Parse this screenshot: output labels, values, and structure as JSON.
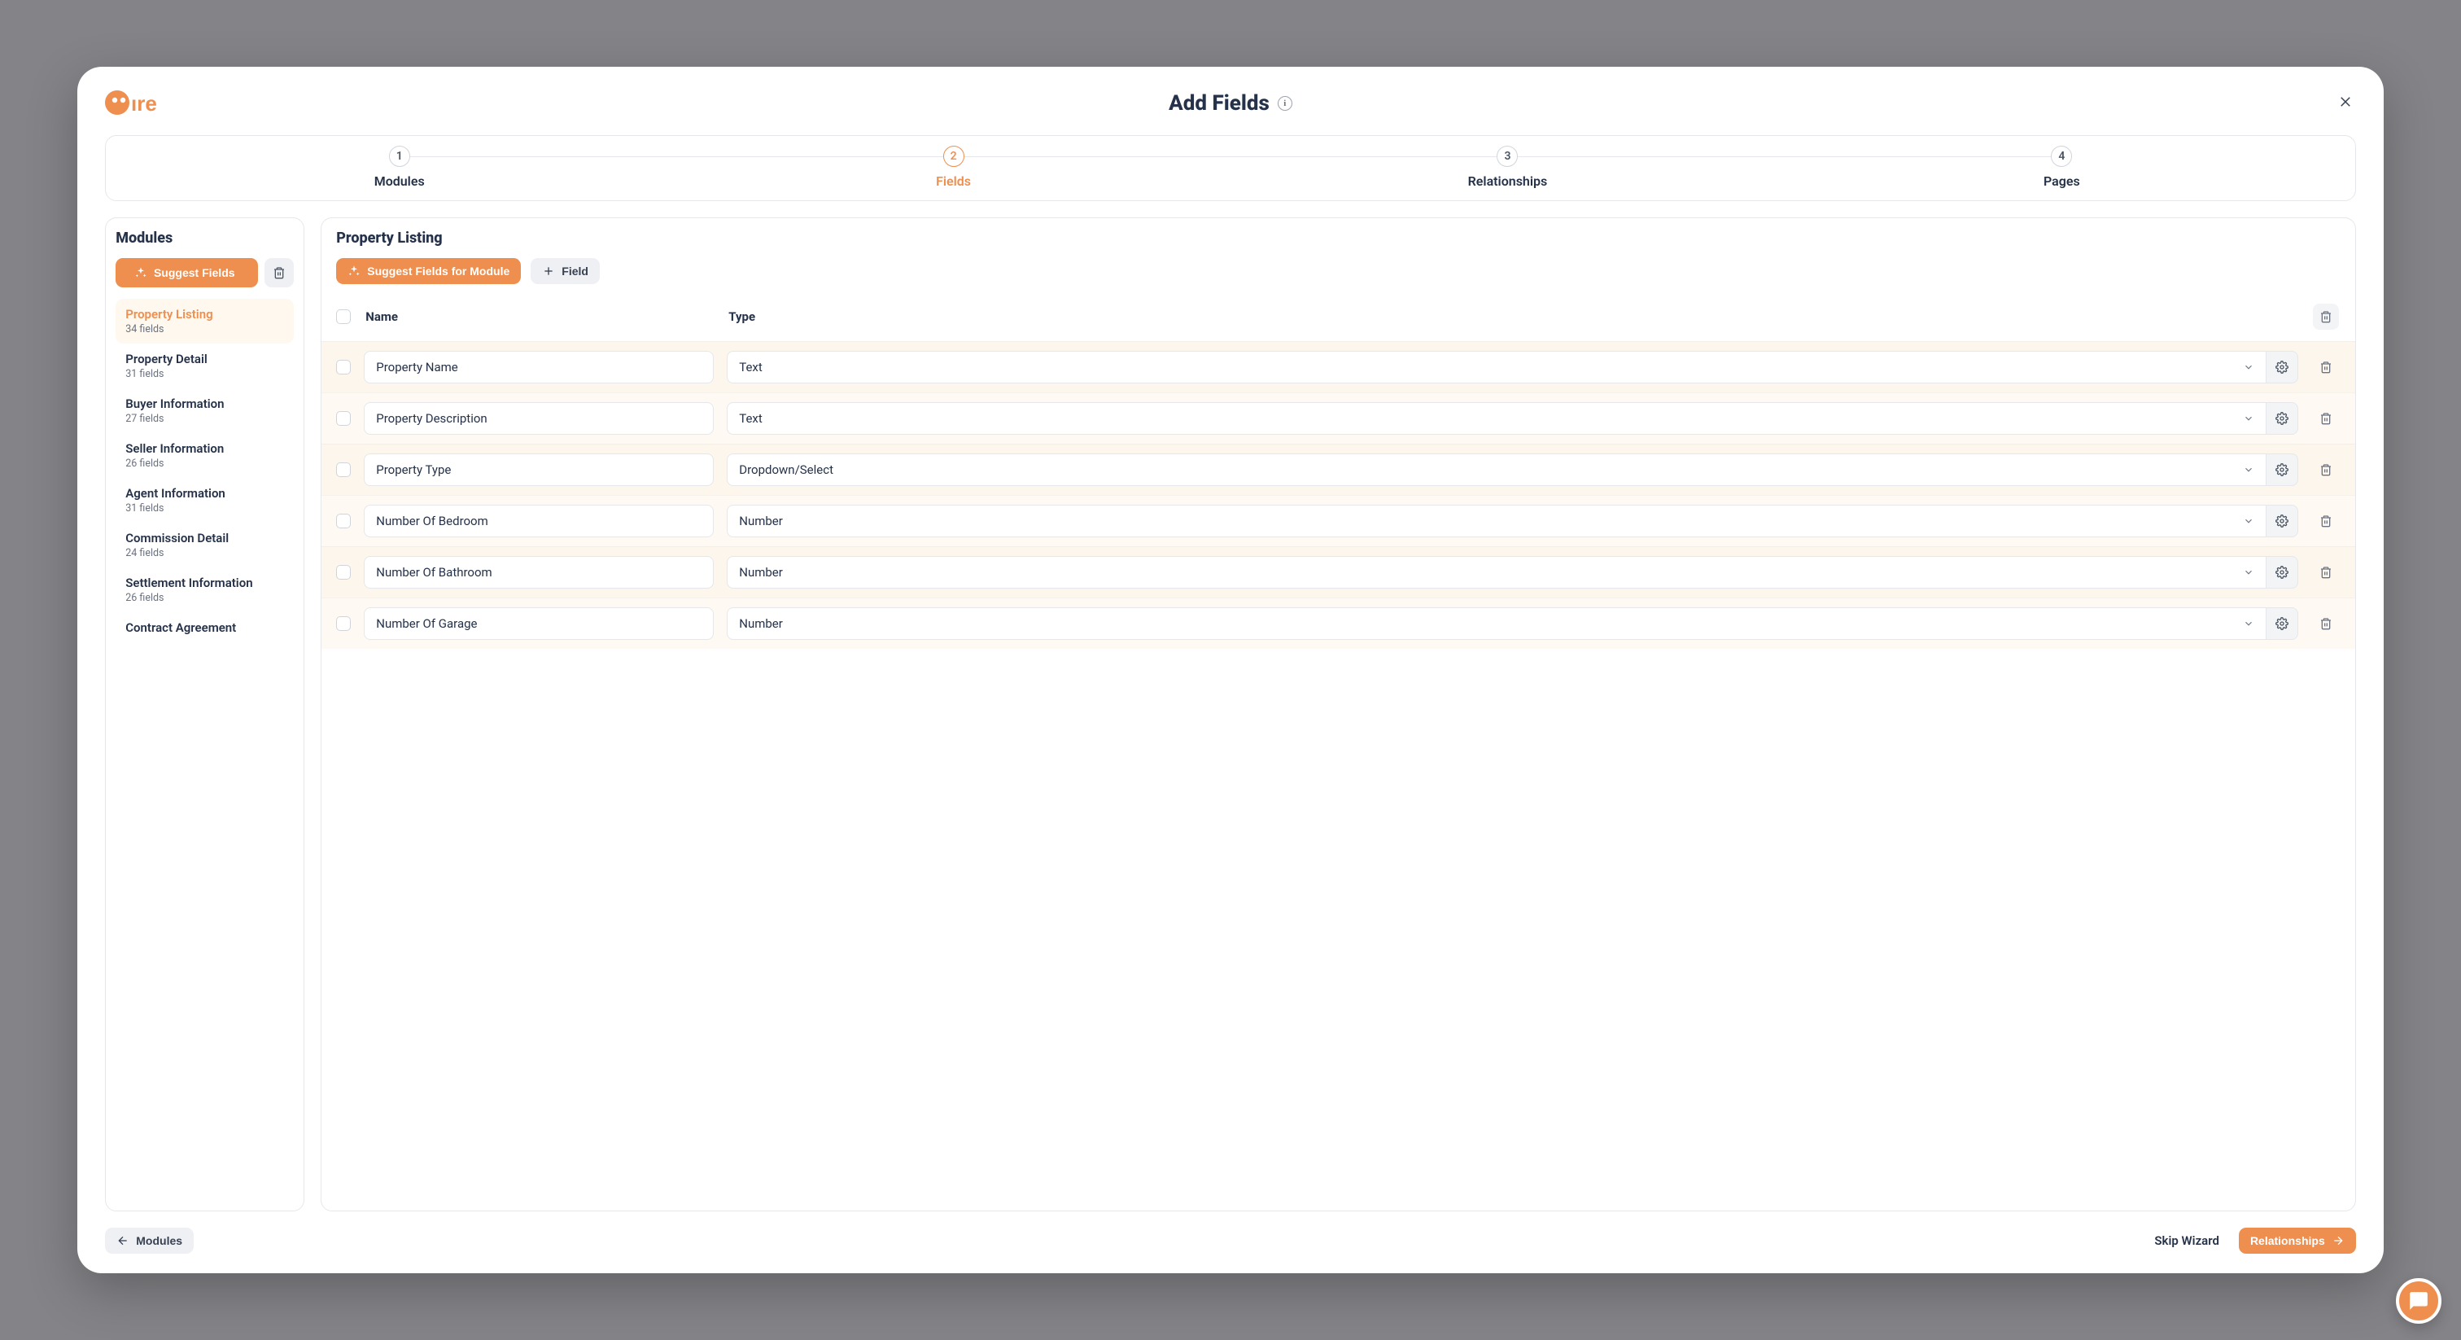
{
  "header": {
    "title": "Add Fields"
  },
  "stepper": [
    {
      "num": "1",
      "label": "Modules",
      "active": false
    },
    {
      "num": "2",
      "label": "Fields",
      "active": true
    },
    {
      "num": "3",
      "label": "Relationships",
      "active": false
    },
    {
      "num": "4",
      "label": "Pages",
      "active": false
    }
  ],
  "sidebar": {
    "title": "Modules",
    "suggest_label": "Suggest Fields",
    "items": [
      {
        "name": "Property Listing",
        "count": "34 fields",
        "active": true
      },
      {
        "name": "Property Detail",
        "count": "31 fields",
        "active": false
      },
      {
        "name": "Buyer Information",
        "count": "27 fields",
        "active": false
      },
      {
        "name": "Seller Information",
        "count": "26 fields",
        "active": false
      },
      {
        "name": "Agent Information",
        "count": "31 fields",
        "active": false
      },
      {
        "name": "Commission Detail",
        "count": "24 fields",
        "active": false
      },
      {
        "name": "Settlement Information",
        "count": "26 fields",
        "active": false
      },
      {
        "name": "Contract Agreement",
        "count": "",
        "active": false
      }
    ]
  },
  "main": {
    "title": "Property Listing",
    "suggest_module_label": "Suggest Fields for Module",
    "add_field_label": "Field",
    "columns": {
      "name": "Name",
      "type": "Type"
    },
    "rows": [
      {
        "name": "Property Name",
        "type": "Text"
      },
      {
        "name": "Property Description",
        "type": "Text"
      },
      {
        "name": "Property Type",
        "type": "Dropdown/Select"
      },
      {
        "name": "Number Of Bedroom",
        "type": "Number"
      },
      {
        "name": "Number Of Bathroom",
        "type": "Number"
      },
      {
        "name": "Number Of Garage",
        "type": "Number"
      }
    ]
  },
  "footer": {
    "back_label": "Modules",
    "skip_label": "Skip Wizard",
    "next_label": "Relationships"
  }
}
